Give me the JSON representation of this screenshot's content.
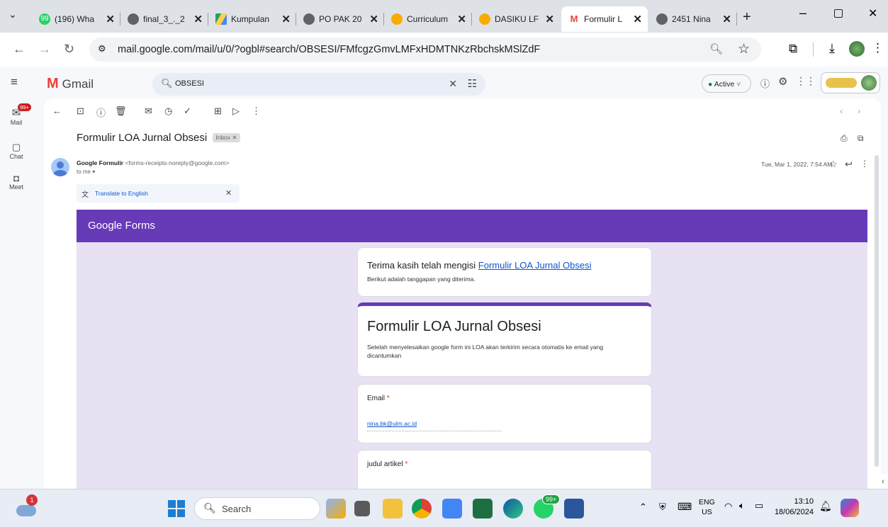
{
  "tabs": [
    {
      "label": "(196) Wha",
      "fav": "99",
      "favColor": "#25d366"
    },
    {
      "label": "final_3_._2",
      "fav": "",
      "favColor": "#5f6368"
    },
    {
      "label": "Kumpulan",
      "fav": "",
      "favColor": "#1fa463"
    },
    {
      "label": "PO PAK 20",
      "fav": "",
      "favColor": "#5f6368"
    },
    {
      "label": "Curriculum",
      "fav": "",
      "favColor": "#f9ab00"
    },
    {
      "label": "DASIKU LF",
      "fav": "",
      "favColor": "#f9ab00"
    },
    {
      "label": "Formulir L",
      "fav": "M",
      "favColor": "#ea4335"
    },
    {
      "label": "2451 Nina",
      "fav": "",
      "favColor": "#5f6368"
    }
  ],
  "url": "mail.google.com/mail/u/0/?ogbl#search/OBSESI/FMfcgzGmvLMFxHDMTNKzRbchskMSlZdF",
  "gmail": {
    "logo": "Gmail",
    "search_value": "OBSESI",
    "status": "Active",
    "mail_badge": "99+",
    "rail": [
      "Mail",
      "Chat",
      "Meet"
    ]
  },
  "email": {
    "subject": "Formulir LOA Jurnal Obsesi",
    "label": "Inbox",
    "sender": "Google Formulir",
    "sender_email": "<forms-receipts-noreply@google.com>",
    "to": "to me",
    "date": "Tue, Mar 1, 2022, 7:54 AM",
    "translate": "Translate to English"
  },
  "form": {
    "brand": "Google Forms",
    "thanks_prefix": "Terima kasih telah mengisi ",
    "thanks_link": "Formulir LOA Jurnal Obsesi",
    "thanks_sub": "Berikut adalah tanggapan yang diterima.",
    "title": "Formulir LOA Jurnal Obsesi",
    "description": "Setelah menyelesaikan google form ini LOA akan terkirim secara otomatis ke email yang dicantumkan",
    "q1_label": "Email",
    "q1_value": "nina.bk@ulm.ac.id",
    "q2_label": "judul artikel",
    "required": "*"
  },
  "taskbar": {
    "search": "Search",
    "lang": "ENG",
    "region": "US",
    "time": "13:10",
    "date": "18/06/2024",
    "wa_badge": "99+",
    "notif_badge": "1"
  }
}
